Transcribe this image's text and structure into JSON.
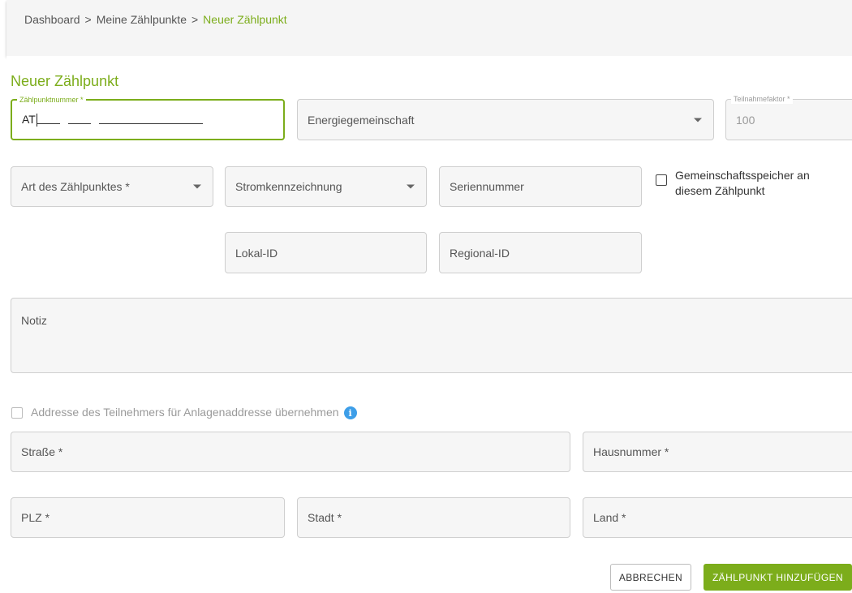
{
  "breadcrumb": {
    "items": [
      "Dashboard",
      "Meine Zählpunkte",
      "Neuer Zählpunkt"
    ],
    "separator": ">"
  },
  "page": {
    "title": "Neuer Zählpunkt"
  },
  "form": {
    "zaehlpunktnummer": {
      "label": "Zählpunktnummer *",
      "value_prefix": "AT"
    },
    "energiegemeinschaft": {
      "label": "Energiegemeinschaft"
    },
    "teilnahmefaktor": {
      "label": "Teilnahmefaktor *",
      "value": "100"
    },
    "art": {
      "label": "Art des Zählpunktes *"
    },
    "stromkennzeichnung": {
      "label": "Stromkennzeichnung"
    },
    "seriennummer": {
      "label": "Seriennummer"
    },
    "gemeinschaftsspeicher": {
      "label_line1": "Gemeinschaftsspeicher an",
      "label_line2": "diesem Zählpunkt"
    },
    "lokal_id": {
      "label": "Lokal-ID"
    },
    "regional_id": {
      "label": "Regional-ID"
    },
    "notiz": {
      "label": "Notiz"
    },
    "adresse_uebernehmen": {
      "label": "Addresse des Teilnehmers für Anlagenaddresse übernehmen"
    },
    "strasse": {
      "label": "Straße *"
    },
    "hausnummer": {
      "label": "Hausnummer *"
    },
    "plz": {
      "label": "PLZ *"
    },
    "stadt": {
      "label": "Stadt *"
    },
    "land": {
      "label": "Land *"
    }
  },
  "actions": {
    "cancel": "ABBRECHEN",
    "submit": "ZÄHLPUNKT HINZUFÜGEN"
  },
  "colors": {
    "accent": "#7cad1b",
    "info": "#3d9ee8"
  },
  "icons": {
    "dropdown": "chevron-down-icon",
    "info": "info-icon"
  }
}
